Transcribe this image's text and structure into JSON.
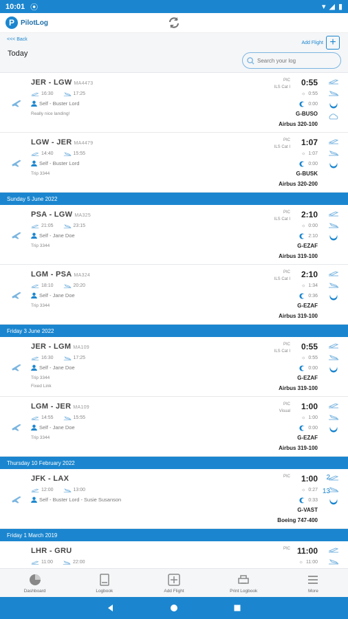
{
  "status": {
    "time": "10:01"
  },
  "app": {
    "title": "PilotLog"
  },
  "subheader": {
    "back": "<<< Back",
    "title": "Today",
    "add_flight": "Add Flight",
    "search_placeholder": "Search your log"
  },
  "colors": {
    "accent": "#1b86cf"
  },
  "groups": [
    {
      "date": "",
      "entries": [
        {
          "from": "JER",
          "to": "LGW",
          "flight_no": "MA4473",
          "dep_time": "16:30",
          "arr_time": "17:25",
          "crew": "Self - Buster Lord",
          "notes": [
            "Really nice landing!"
          ],
          "role1": "PIC",
          "role2": "ILS Cat I",
          "total": "0:55",
          "day": "0:55",
          "night": "0:00",
          "reg": "G-BUSO",
          "type": "Airbus 320-100"
        },
        {
          "from": "LGW",
          "to": "JER",
          "flight_no": "MA4479",
          "dep_time": "14:40",
          "arr_time": "15:55",
          "crew": "Self - Buster Lord",
          "notes": [
            "Trip 3344"
          ],
          "role1": "PIC",
          "role2": "ILS Cat I",
          "total": "1:07",
          "day": "1:07",
          "night": "0:00",
          "reg": "G-BUSK",
          "type": "Airbus 320-200"
        }
      ]
    },
    {
      "date": "Sunday 5 June 2022",
      "entries": [
        {
          "from": "PSA",
          "to": "LGW",
          "flight_no": "MA325",
          "dep_time": "21:05",
          "arr_time": "23:15",
          "crew": "Self - Jane Doe",
          "notes": [
            "Trip 3344"
          ],
          "role1": "PIC",
          "role2": "ILS Cat I",
          "total": "2:10",
          "day": "0:00",
          "night": "2:10",
          "reg": "G-EZAF",
          "type": "Airbus 319-100"
        },
        {
          "from": "LGM",
          "to": "PSA",
          "flight_no": "MA324",
          "dep_time": "18:10",
          "arr_time": "20:20",
          "crew": "Self - Jane Doe",
          "notes": [
            "Trip 3344"
          ],
          "role1": "PIC",
          "role2": "ILS Cat I",
          "total": "2:10",
          "day": "1:34",
          "night": "0:36",
          "reg": "G-EZAF",
          "type": "Airbus 319-100"
        }
      ]
    },
    {
      "date": "Friday 3 June 2022",
      "entries": [
        {
          "from": "JER",
          "to": "LGM",
          "flight_no": "MA109",
          "dep_time": "16:30",
          "arr_time": "17:25",
          "crew": "Self - Jane Doe",
          "notes": [
            "Trip 3344",
            "Fixed Link"
          ],
          "role1": "PIC",
          "role2": "ILS Cat I",
          "total": "0:55",
          "day": "0:55",
          "night": "0:00",
          "reg": "G-EZAF",
          "type": "Airbus 319-100"
        },
        {
          "from": "LGM",
          "to": "JER",
          "flight_no": "MA109",
          "dep_time": "14:55",
          "arr_time": "15:55",
          "crew": "Self - Jane Doe",
          "notes": [
            "Trip 3344"
          ],
          "role1": "PIC",
          "role2": "Visual",
          "total": "1:00",
          "day": "1:00",
          "night": "0:00",
          "reg": "G-EZAF",
          "type": "Airbus 319-100"
        }
      ]
    },
    {
      "date": "Thursday 10 February 2022",
      "entries": [
        {
          "from": "JFK",
          "to": "LAX",
          "flight_no": "",
          "dep_time": "12:00",
          "arr_time": "13:00",
          "crew": "Self - Buster Lord - Susie Susanson",
          "notes": [],
          "role1": "PIC",
          "role2": "",
          "total": "1:00",
          "day": "0:27",
          "night": "0:33",
          "reg": "G-VAST",
          "type": "Boeing 747-400",
          "side1": "2",
          "side2": "13"
        }
      ]
    },
    {
      "date": "Friday 1 March 2019",
      "entries": [
        {
          "from": "LHR",
          "to": "GRU",
          "flight_no": "",
          "dep_time": "11:00",
          "arr_time": "22:00",
          "crew": "",
          "notes": [],
          "role1": "PIC",
          "role2": "",
          "total": "11:00",
          "day": "11:00",
          "night": "",
          "reg": "",
          "type": ""
        }
      ]
    }
  ],
  "nav": [
    {
      "label": "Dashboard",
      "icon": "pie-chart-icon"
    },
    {
      "label": "Logbook",
      "icon": "book-icon"
    },
    {
      "label": "Add Flight",
      "icon": "plus-icon"
    },
    {
      "label": "Print Logbook",
      "icon": "print-icon"
    },
    {
      "label": "More",
      "icon": "menu-icon"
    }
  ]
}
